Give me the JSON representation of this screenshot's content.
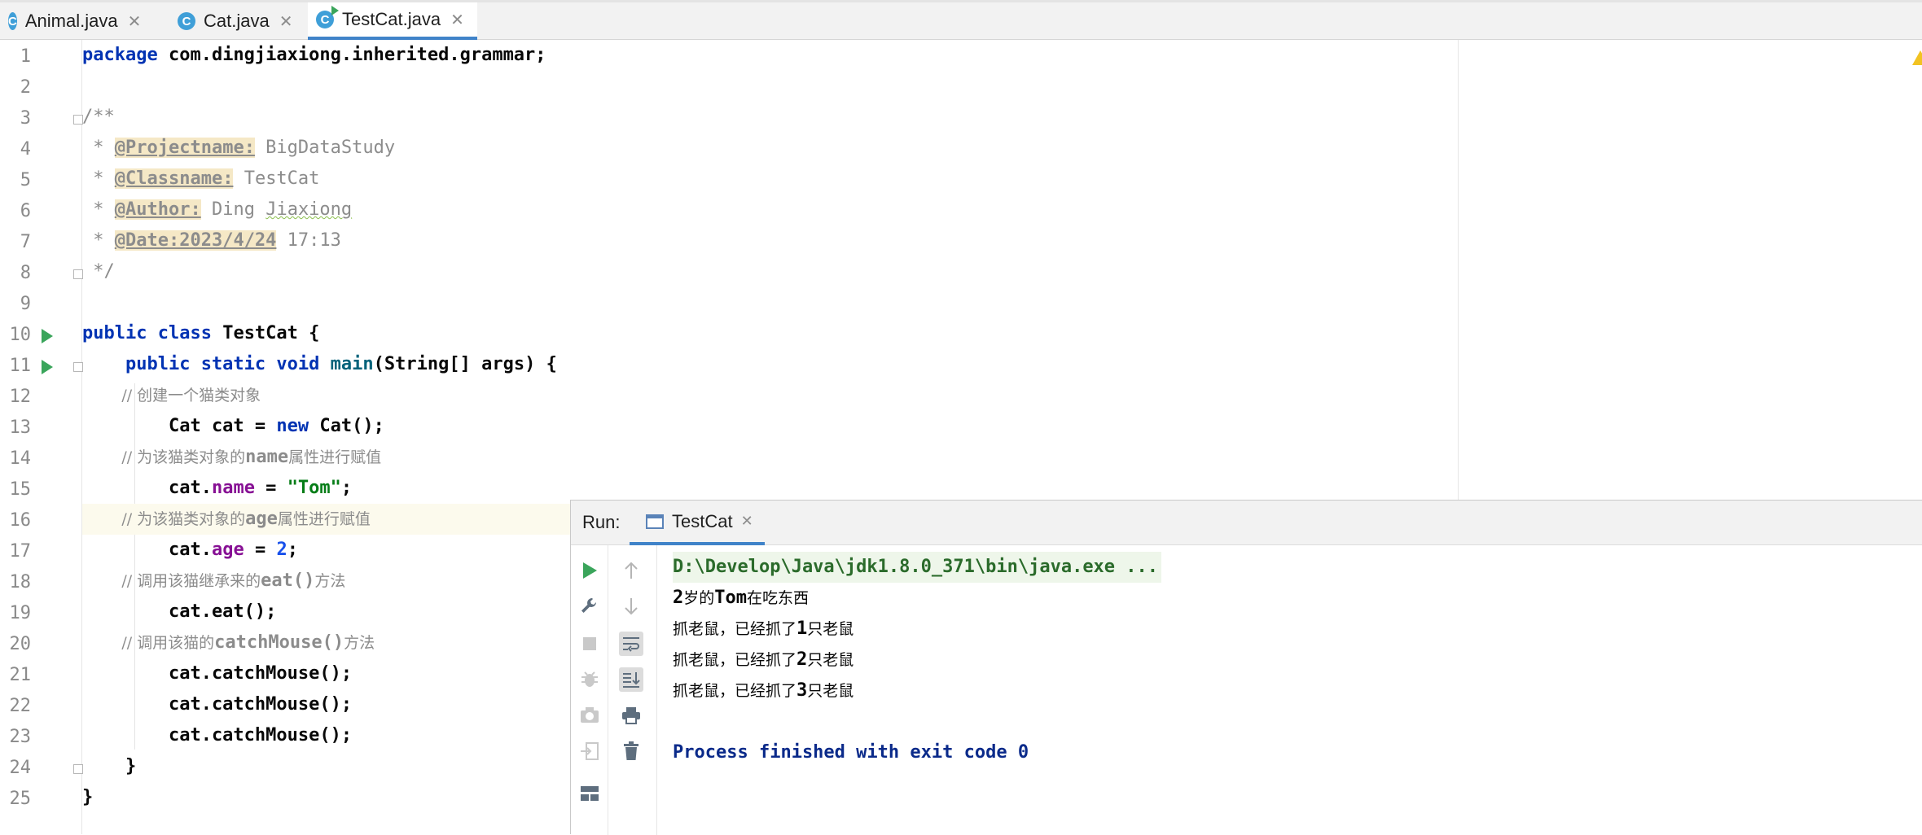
{
  "tabs": [
    {
      "label": "Animal.java",
      "icon": "class-icon",
      "active": false
    },
    {
      "label": "Cat.java",
      "icon": "class-icon",
      "active": false
    },
    {
      "label": "TestCat.java",
      "icon": "runnable-class-icon",
      "active": true
    }
  ],
  "editor": {
    "line_numbers": [
      "1",
      "2",
      "3",
      "4",
      "5",
      "6",
      "7",
      "8",
      "9",
      "10",
      "11",
      "12",
      "13",
      "14",
      "15",
      "16",
      "17",
      "18",
      "19",
      "20",
      "21",
      "22",
      "23",
      "24",
      "25"
    ],
    "code": {
      "l1_kw": "package",
      "l1_rest": " com.dingjiaxiong.inherited.grammar;",
      "l3": "/**",
      "l4_pre": " * ",
      "l4_tag": "@Projectname:",
      "l4_val": " BigDataStudy",
      "l5_pre": " * ",
      "l5_tag": "@Classname:",
      "l5_val": " TestCat",
      "l6_pre": " * ",
      "l6_tag": "@Author:",
      "l6_val_a": " Ding ",
      "l6_val_b": "Jiaxiong",
      "l7_pre": " * ",
      "l7_tag": "@Date:2023/4/24",
      "l7_val": " 17:13",
      "l8": " */",
      "l10_kw": "public class",
      "l10_rest": " TestCat {",
      "l11_kw": "    public static void",
      "l11_mth": " main",
      "l11_rest": "(String[] args) {",
      "l12_cm": "        // 创建一个猫类对象",
      "l13_a": "        Cat cat = ",
      "l13_kw": "new",
      "l13_b": " Cat();",
      "l14_cm_a": "        // 为该猫类对象的",
      "l14_cm_b": "name",
      "l14_cm_c": "属性进行赋值",
      "l15_a": "        cat.",
      "l15_fld": "name",
      "l15_b": " = ",
      "l15_str": "\"Tom\"",
      "l15_c": ";",
      "l16_cm_a": "        // 为该猫类对象的",
      "l16_cm_b": "age",
      "l16_cm_c": "属性进行赋值",
      "l17_a": "        cat.",
      "l17_fld": "age",
      "l17_b": " = ",
      "l17_num": "2",
      "l17_c": ";",
      "l18_cm_a": "        // 调用该猫继承来的",
      "l18_cm_b": "eat()",
      "l18_cm_c": "方法",
      "l19": "        cat.eat();",
      "l20_cm_a": "        // 调用该猫的",
      "l20_cm_b": "catchMouse()",
      "l20_cm_c": "方法",
      "l21": "        cat.catchMouse();",
      "l22": "        cat.catchMouse();",
      "l23": "        cat.catchMouse();",
      "l24": "    }",
      "l25": "}"
    }
  },
  "run_panel": {
    "label": "Run:",
    "tab_label": "TestCat",
    "console": {
      "cmd": "D:\\Develop\\Java\\jdk1.8.0_371\\bin\\java.exe ...",
      "out1_a": "2",
      "out1_b": "岁的",
      "out1_c": "Tom",
      "out1_d": "在吃东西",
      "out2_a": "抓老鼠，已经抓了",
      "out2_b": "1",
      "out2_c": "只老鼠",
      "out3_a": "抓老鼠，已经抓了",
      "out3_b": "2",
      "out3_c": "只老鼠",
      "out4_a": "抓老鼠，已经抓了",
      "out4_b": "3",
      "out4_c": "只老鼠",
      "exit": "Process finished with exit code 0"
    }
  },
  "colors": {
    "keyword": "#0033b3",
    "field": "#871094",
    "string": "#067d17",
    "number": "#1750eb",
    "comment": "#8c8c8c",
    "run_green": "#3aa55b",
    "tab_accent": "#4083c9"
  }
}
